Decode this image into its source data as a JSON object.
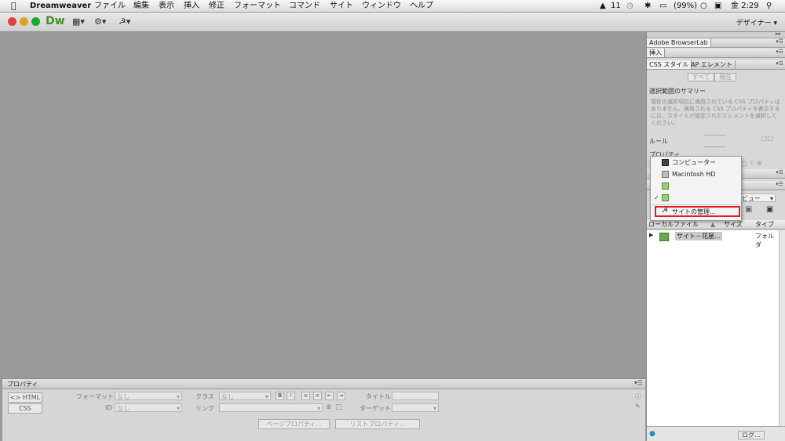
{
  "menubar": {
    "apple_icon": "apple-icon",
    "app_name": "Dreamweaver",
    "menus": [
      "ファイル",
      "編集",
      "表示",
      "挿入",
      "修正",
      "フォーマット",
      "コマンド",
      "サイト",
      "ウィンドウ",
      "ヘルプ"
    ],
    "status_num": "11",
    "battery": "(99%)",
    "clock": "金 2:29"
  },
  "app_toolbar": {
    "logo": "Dw",
    "workspace": "デザイナー"
  },
  "right_panels": {
    "browserlab": "Adobe BrowserLab",
    "insert_tab": "挿入",
    "css_tab": "CSS スタイル",
    "ap_tab": "AP エレメント",
    "all_btn": "すべて",
    "current_btn": "現在",
    "summary_title": "選択範囲のサマリー",
    "summary_text": "現在の選択項目に適用されている CSS プロパティはありません。適用される CSS プロパティを表示するには、スタイルが設定されたエレメントを選択してください。",
    "rules_label": "ルール",
    "properties_label": "プロパティ",
    "view_select": "ビュー",
    "col_local": "ローカルファイル",
    "col_size": "サイズ",
    "col_type": "タイプ",
    "file_row_name": "サイト－花屋...",
    "file_row_type": "フォルダ",
    "log_button": "ログ..."
  },
  "dropdown": {
    "items": [
      "コンピューター",
      "Macintosh HD",
      "",
      "",
      "サイトの管理..."
    ]
  },
  "properties": {
    "tab_label": "プロパティ",
    "html_btn": "HTML",
    "css_btn": "CSS",
    "format_label": "フォーマット",
    "format_value": "なし",
    "class_label": "クラス",
    "class_value": "なし",
    "id_label": "ID",
    "id_value": "なし",
    "link_label": "リンク",
    "title_label": "タイトル",
    "target_label": "ターゲット",
    "page_props_btn": "ページプロパティ...",
    "list_props_btn": "リストプロパティ...",
    "bold_btn": "B",
    "italic_btn": "I"
  }
}
